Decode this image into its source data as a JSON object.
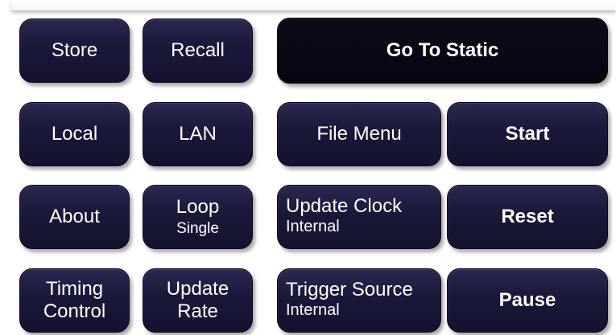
{
  "buttons": {
    "store": "Store",
    "recall": "Recall",
    "go_to_static": "Go To Static",
    "local": "Local",
    "lan": "LAN",
    "file_menu": "File Menu",
    "start": "Start",
    "about": "About",
    "loop": {
      "label": "Loop",
      "value": "Single"
    },
    "update_clock": {
      "label": "Update Clock",
      "value": "Internal"
    },
    "reset": "Reset",
    "timing_control": {
      "line1": "Timing",
      "line2": "Control"
    },
    "update_rate": {
      "line1": "Update",
      "line2": "Rate"
    },
    "trigger_source": {
      "label": "Trigger Source",
      "value": "Internal"
    },
    "pause": "Pause"
  }
}
